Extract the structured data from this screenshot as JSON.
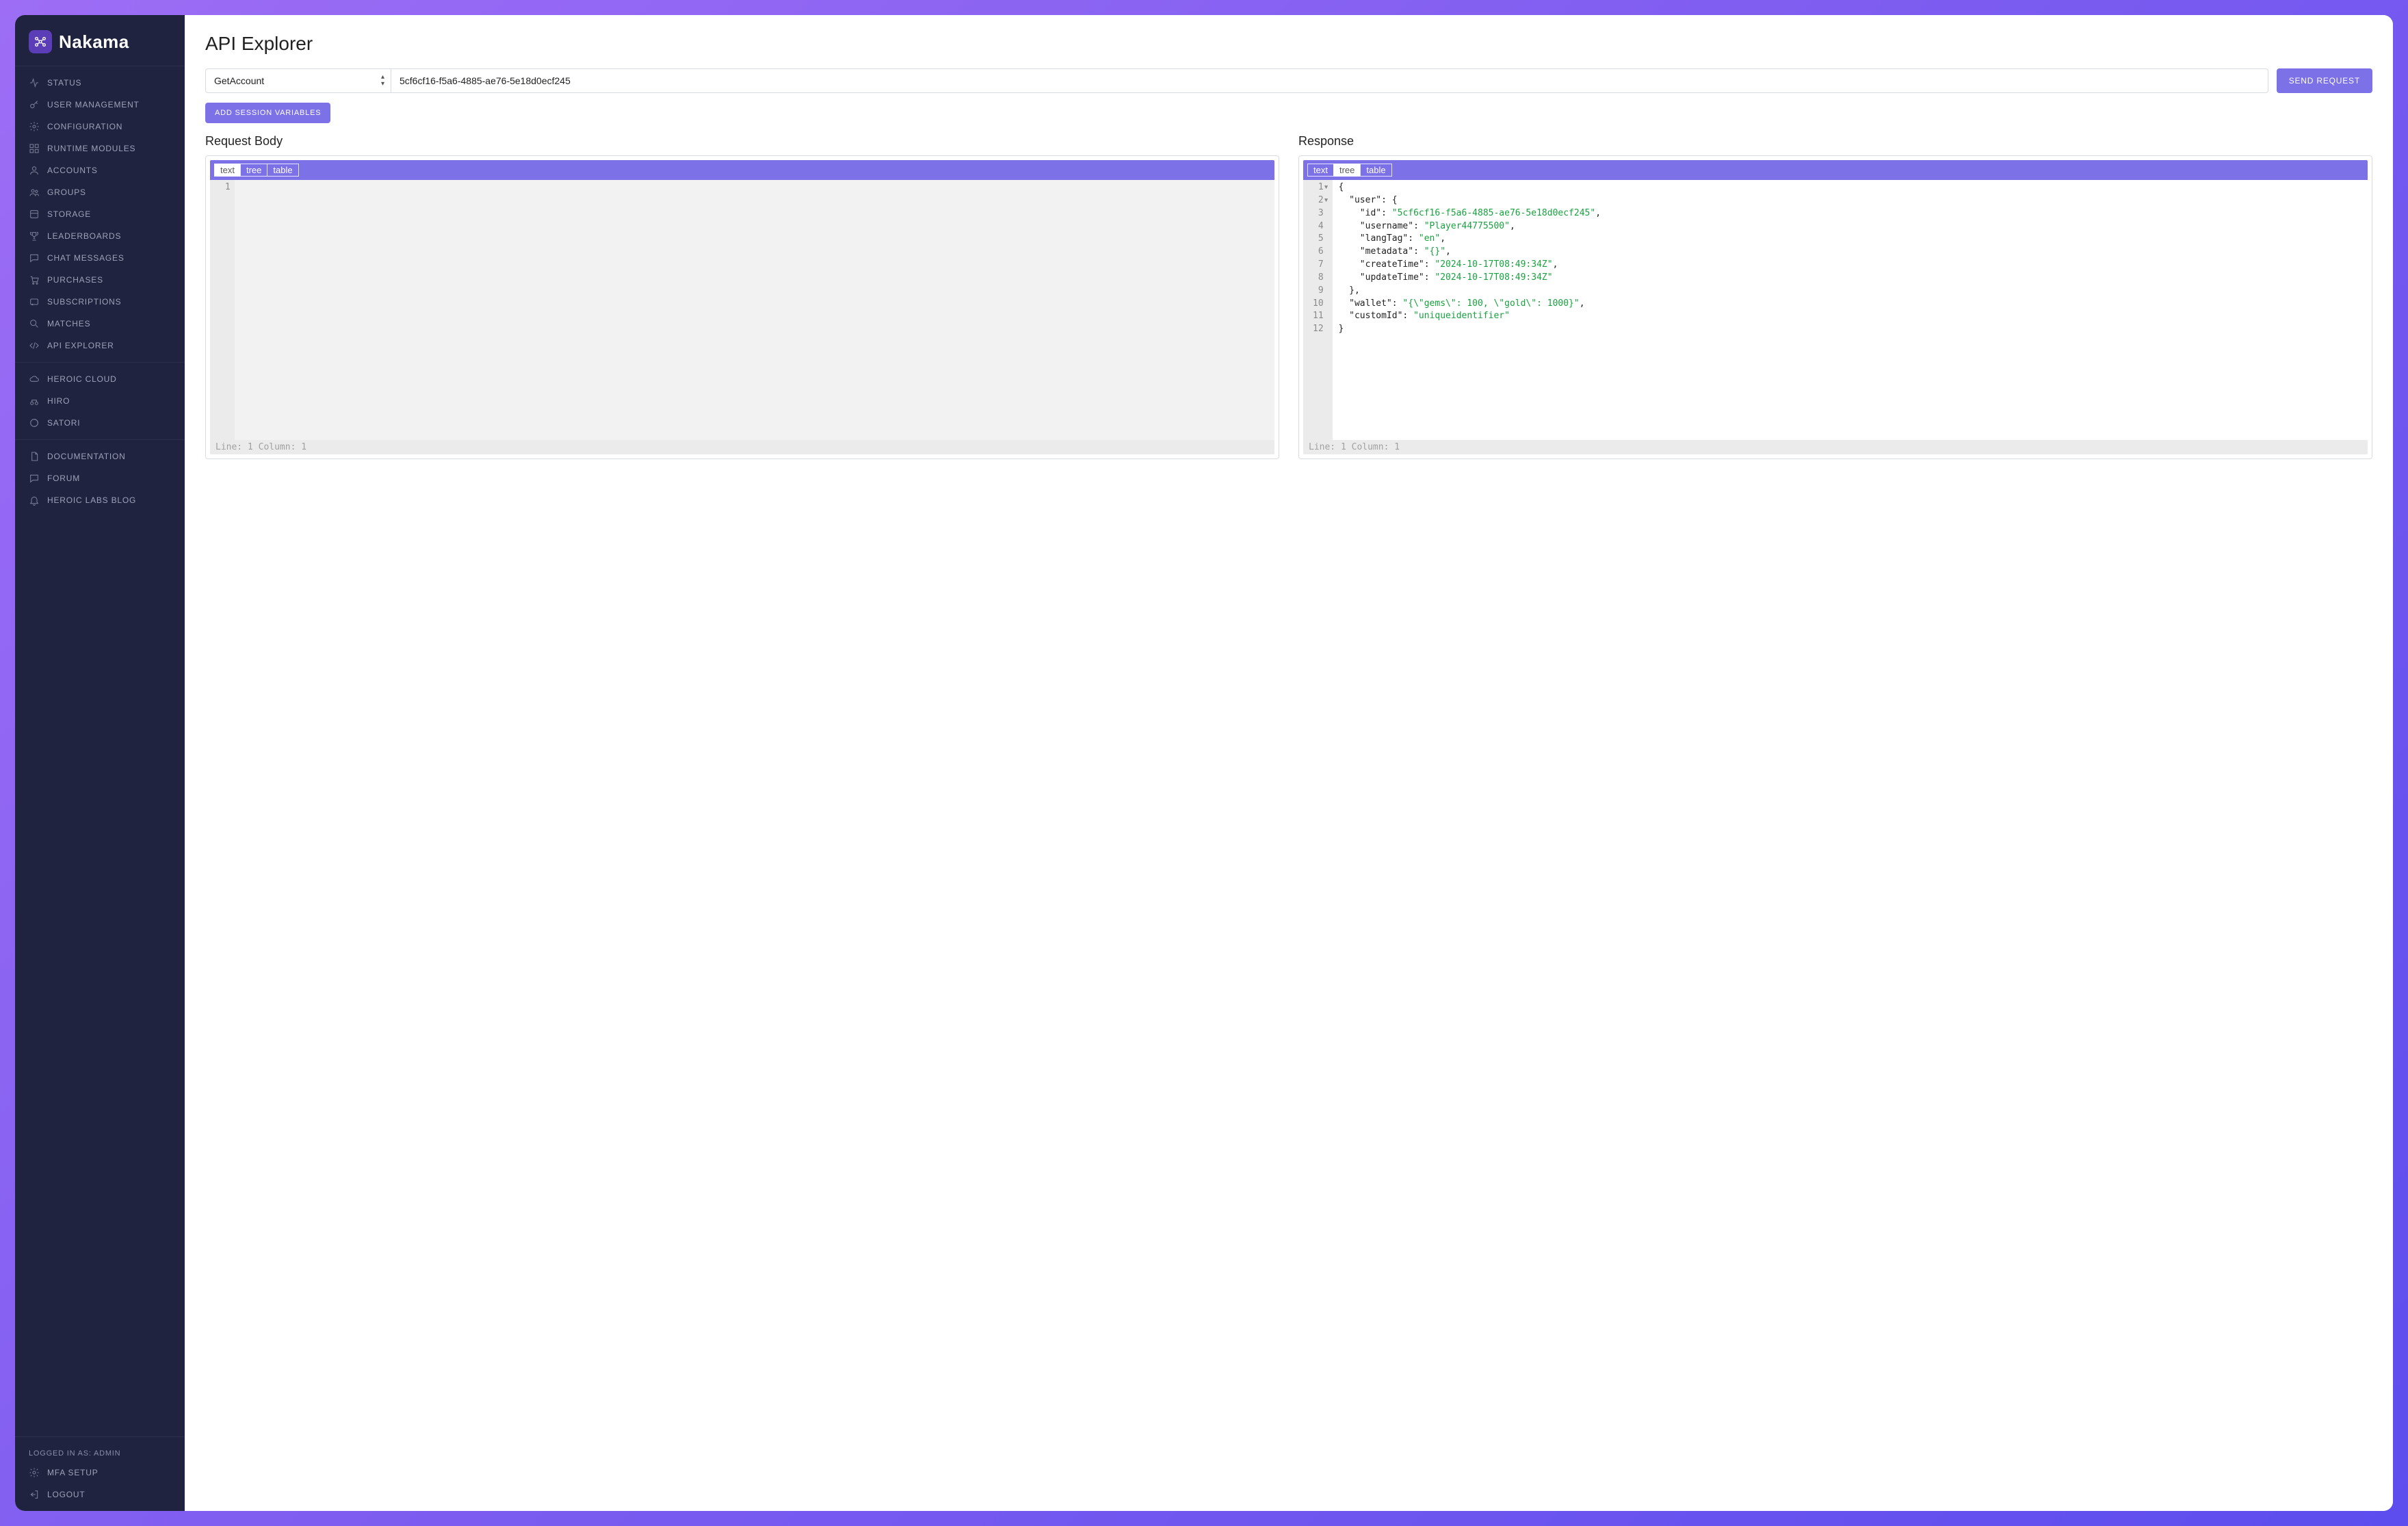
{
  "brand": {
    "name": "Nakama"
  },
  "sidebar": {
    "items": [
      {
        "label": "Status"
      },
      {
        "label": "User Management"
      },
      {
        "label": "Configuration"
      },
      {
        "label": "Runtime Modules"
      },
      {
        "label": "Accounts"
      },
      {
        "label": "Groups"
      },
      {
        "label": "Storage"
      },
      {
        "label": "Leaderboards"
      },
      {
        "label": "Chat Messages"
      },
      {
        "label": "Purchases"
      },
      {
        "label": "Subscriptions"
      },
      {
        "label": "Matches"
      },
      {
        "label": "API Explorer"
      }
    ],
    "ext": [
      {
        "label": "Heroic Cloud"
      },
      {
        "label": "Hiro"
      },
      {
        "label": "Satori"
      }
    ],
    "links": [
      {
        "label": "Documentation"
      },
      {
        "label": "Forum"
      },
      {
        "label": "Heroic Labs Blog"
      }
    ],
    "footer": {
      "logged_in": "Logged in as: admin",
      "mfa": "MFA Setup",
      "logout": "Logout"
    }
  },
  "page": {
    "title": "API Explorer",
    "endpoint_selected": "GetAccount",
    "user_id": "5cf6cf16-f5a6-4885-ae76-5e18d0ecf245",
    "send_label": "Send Request",
    "add_vars_label": "Add Session Variables"
  },
  "panels": {
    "request": {
      "title": "Request Body",
      "tabs": [
        "text",
        "tree",
        "table"
      ],
      "active_tab": "text",
      "body_lines": [
        ""
      ],
      "status": "Line: 1  Column: 1"
    },
    "response": {
      "title": "Response",
      "tabs": [
        "text",
        "tree",
        "table"
      ],
      "active_tab": "tree",
      "status": "Line: 1  Column: 1",
      "json": {
        "user": {
          "id": "5cf6cf16-f5a6-4885-ae76-5e18d0ecf245",
          "username": "Player44775500",
          "langTag": "en",
          "metadata": "{}",
          "createTime": "2024-10-17T08:49:34Z",
          "updateTime": "2024-10-17T08:49:34Z"
        },
        "wallet": "{\"gems\": 100, \"gold\": 1000}",
        "customId": "uniqueidentifier"
      },
      "lines": [
        [
          [
            "pun",
            "{"
          ]
        ],
        [
          [
            "pad",
            "  "
          ],
          [
            "key",
            "\"user\""
          ],
          [
            "pun",
            ": {"
          ]
        ],
        [
          [
            "pad",
            "    "
          ],
          [
            "key",
            "\"id\""
          ],
          [
            "pun",
            ": "
          ],
          [
            "str",
            "\"5cf6cf16-f5a6-4885-ae76-5e18d0ecf245\""
          ],
          [
            "pun",
            ","
          ]
        ],
        [
          [
            "pad",
            "    "
          ],
          [
            "key",
            "\"username\""
          ],
          [
            "pun",
            ": "
          ],
          [
            "str",
            "\"Player44775500\""
          ],
          [
            "pun",
            ","
          ]
        ],
        [
          [
            "pad",
            "    "
          ],
          [
            "key",
            "\"langTag\""
          ],
          [
            "pun",
            ": "
          ],
          [
            "str",
            "\"en\""
          ],
          [
            "pun",
            ","
          ]
        ],
        [
          [
            "pad",
            "    "
          ],
          [
            "key",
            "\"metadata\""
          ],
          [
            "pun",
            ": "
          ],
          [
            "str",
            "\"{}\""
          ],
          [
            "pun",
            ","
          ]
        ],
        [
          [
            "pad",
            "    "
          ],
          [
            "key",
            "\"createTime\""
          ],
          [
            "pun",
            ": "
          ],
          [
            "str",
            "\"2024-10-17T08:49:34Z\""
          ],
          [
            "pun",
            ","
          ]
        ],
        [
          [
            "pad",
            "    "
          ],
          [
            "key",
            "\"updateTime\""
          ],
          [
            "pun",
            ": "
          ],
          [
            "str",
            "\"2024-10-17T08:49:34Z\""
          ]
        ],
        [
          [
            "pad",
            "  "
          ],
          [
            "pun",
            "},"
          ]
        ],
        [
          [
            "pad",
            "  "
          ],
          [
            "key",
            "\"wallet\""
          ],
          [
            "pun",
            ": "
          ],
          [
            "str",
            "\"{\\\"gems\\\": 100, \\\"gold\\\": 1000}\""
          ],
          [
            "pun",
            ","
          ]
        ],
        [
          [
            "pad",
            "  "
          ],
          [
            "key",
            "\"customId\""
          ],
          [
            "pun",
            ": "
          ],
          [
            "str",
            "\"uniqueidentifier\""
          ]
        ],
        [
          [
            "pun",
            "}"
          ]
        ]
      ]
    }
  },
  "colors": {
    "accent": "#7d71e8",
    "sidebar_bg": "#1f2340"
  }
}
